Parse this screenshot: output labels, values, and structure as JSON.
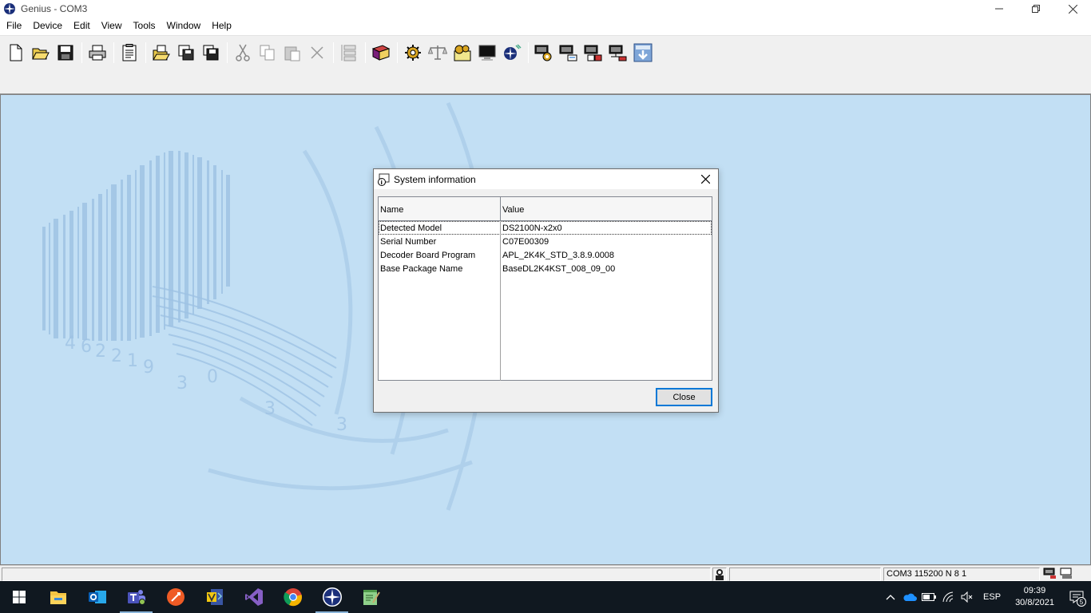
{
  "window": {
    "title": "Genius - COM3",
    "minimize_icon": "minimize-icon",
    "restore_icon": "restore-icon",
    "close_icon": "close-icon"
  },
  "menu": [
    "File",
    "Device",
    "Edit",
    "View",
    "Tools",
    "Window",
    "Help"
  ],
  "toolbar": {
    "icons": [
      "new-file-icon",
      "open-folder-icon",
      "save-icon",
      "print-icon",
      "properties-icon",
      "open-config-icon",
      "copy-config-icon",
      "save-config-icon",
      "cut-icon",
      "copy-icon",
      "paste-icon",
      "delete-icon",
      "align-icon",
      "book-icon",
      "gear-icon",
      "balance-icon",
      "settings-icon",
      "terminal-icon",
      "genius-icon",
      "device-gear-icon",
      "device-send-icon",
      "device-receive-icon",
      "device-network-icon",
      "download-icon"
    ]
  },
  "dialog": {
    "title": "System information",
    "columns": {
      "name": "Name",
      "value": "Value"
    },
    "rows": [
      {
        "name": "Detected Model",
        "value": "DS2100N-x2x0"
      },
      {
        "name": "Serial Number",
        "value": "C07E00309"
      },
      {
        "name": "Decoder Board Program",
        "value": "APL_2K4K_STD_3.8.9.0008"
      },
      {
        "name": "Base Package Name",
        "value": "BaseDL2K4KST_008_09_00"
      }
    ],
    "close_label": "Close"
  },
  "statusbar": {
    "port": "COM3 115200 N 8 1"
  },
  "taskbar": {
    "apps": [
      "file-explorer-icon",
      "outlook-icon",
      "teams-icon",
      "postman-icon",
      "visio-icon",
      "visual-studio-icon",
      "chrome-icon",
      "genius-icon",
      "notepad-icon"
    ],
    "language": "ESP",
    "time": "09:39",
    "date": "30/8/2021",
    "notification_count": "5"
  },
  "colors": {
    "client_bg": "#c2dff4",
    "taskbar_bg": "#101820",
    "accent": "#0078d7"
  }
}
